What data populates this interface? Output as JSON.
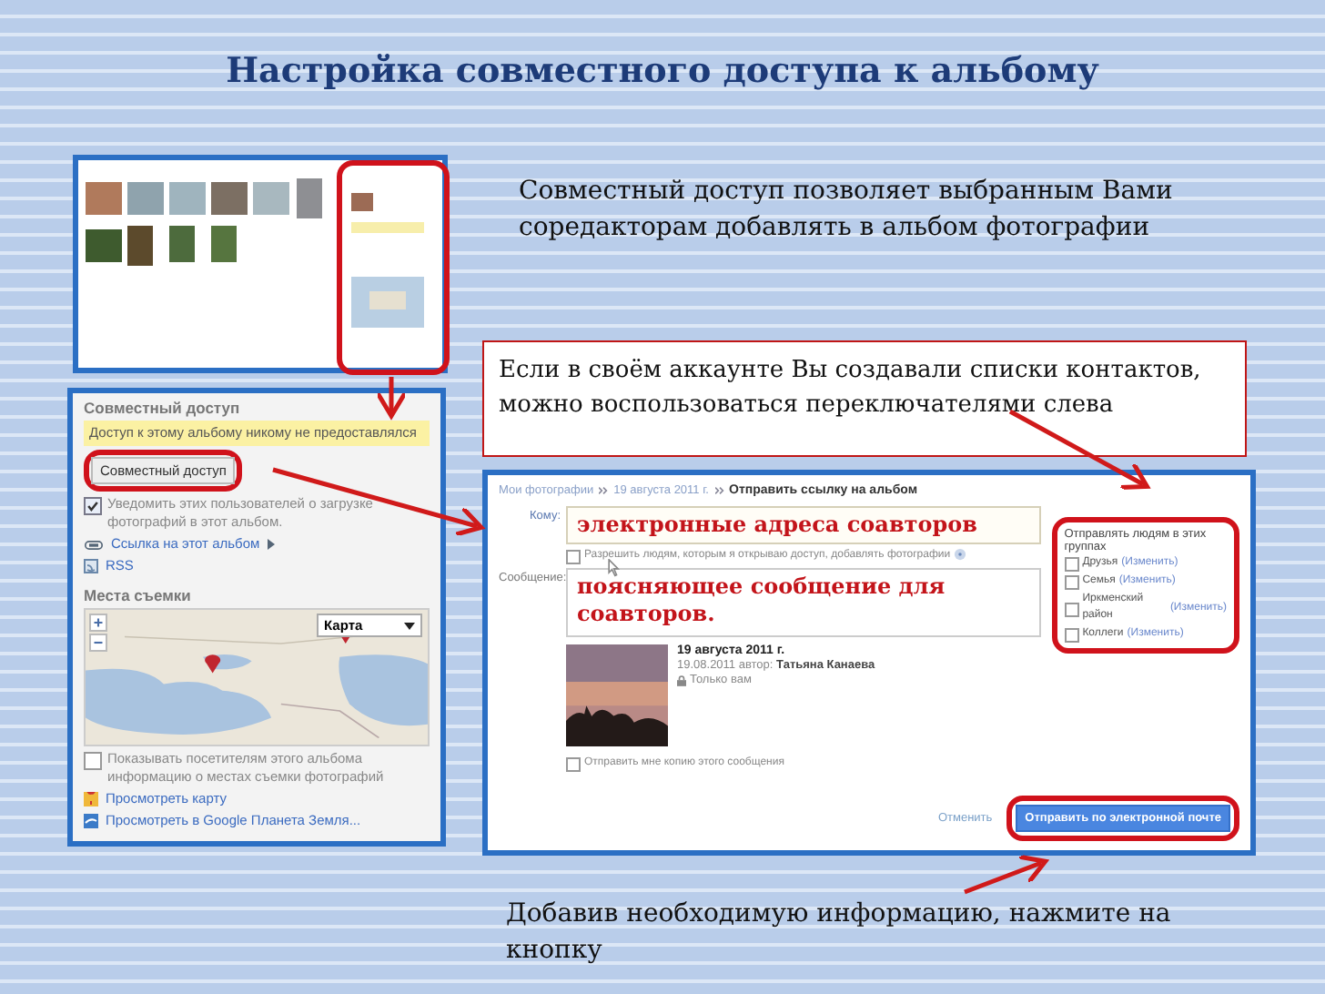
{
  "title": "Настройка совместного доступа к альбому",
  "intro": "Совместный доступ позволяет выбранным Вами соредакторам добавлять в альбом фотографии",
  "note": "Если в своём аккаунте Вы создавали списки контактов, можно воспользоваться переключателями слева",
  "sidebar": {
    "share_heading": "Совместный доступ",
    "share_status": "Доступ к этому альбому никому не предоставлялся",
    "share_button": "Совместный доступ",
    "notify": {
      "label": "Уведомить этих пользователей о загрузке фотографий в этот альбом.",
      "checked": true
    },
    "album_link": "Ссылка на этот альбом",
    "rss": "RSS",
    "places_heading": "Места съемки",
    "map_type": "Карта",
    "show_places": {
      "label": "Показывать посетителям этого альбома информацию о местах съемки фотографий",
      "checked": false
    },
    "map_links": [
      "Просмотреть карту",
      "Просмотреть в Google Планета Земля..."
    ]
  },
  "dialog": {
    "breadcrumb": [
      "Мои фотографии",
      "19 августа 2011 г.",
      "Отправить ссылку на альбом"
    ],
    "to_label": "Кому:",
    "to_value": "электронные адреса соавторов",
    "allow": {
      "label": "Разрешить людям, которым я открываю доступ, добавлять фотографии",
      "checked": false
    },
    "message_label": "Сообщение:",
    "message_value": "поясняющее сообщение для соавторов.",
    "album": {
      "title": "19 августа 2011 г.",
      "byline": "19.08.2011 автор: **Татьяна Канаева**",
      "visibility": "Только вам"
    },
    "copy": {
      "label": "Отправить мне копию этого сообщения",
      "checked": false
    },
    "groups_heading": "Отправлять людям в этих группах",
    "groups": [
      {
        "name": "Друзья",
        "edit": "(Изменить)",
        "checked": false
      },
      {
        "name": "Семья",
        "edit": "(Изменить)",
        "checked": false
      },
      {
        "name": "Иркменский район",
        "edit": "(Изменить)",
        "checked": false
      },
      {
        "name": "Коллеги",
        "edit": "(Изменить)",
        "checked": false
      }
    ],
    "cancel": "Отменить",
    "send": "Отправить по электронной почте"
  },
  "footer": "Добавив необходимую информацию, нажмите на кнопку"
}
